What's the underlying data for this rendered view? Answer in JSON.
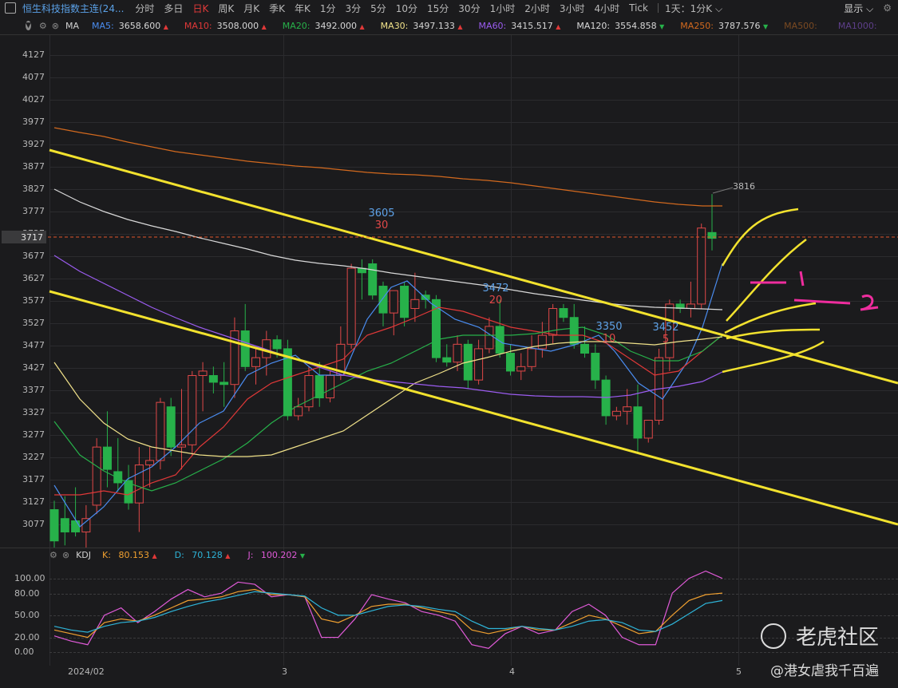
{
  "app": {
    "title": "恒生科技指数主连(24...",
    "display_label": "显示"
  },
  "timeframes": [
    "分时",
    "多日",
    "日K",
    "周K",
    "月K",
    "季K",
    "年K",
    "1分",
    "3分",
    "5分",
    "10分",
    "15分",
    "30分",
    "1小时",
    "2小时",
    "3小时",
    "4小时",
    "Tick"
  ],
  "active_timeframe": "日K",
  "period_select": "1天：1分K",
  "main_indicator": {
    "name": "MA",
    "items": [
      {
        "label": "MA5:",
        "value": "3658.600",
        "arrow": "▲",
        "color": "#4a8cf0"
      },
      {
        "label": "MA10:",
        "value": "3508.000",
        "arrow": "▲",
        "color": "#e03838"
      },
      {
        "label": "MA20:",
        "value": "3492.000",
        "arrow": "▲",
        "color": "#27b14a"
      },
      {
        "label": "MA30:",
        "value": "3497.133",
        "arrow": "▲",
        "color": "#f1e28a"
      },
      {
        "label": "MA60:",
        "value": "3415.517",
        "arrow": "▲",
        "color": "#9b5cf0"
      },
      {
        "label": "MA120:",
        "value": "3554.858",
        "arrow": "▼",
        "color": "#d9d9d9"
      },
      {
        "label": "MA250:",
        "value": "3787.576",
        "arrow": "▼",
        "color": "#d2691e"
      },
      {
        "label": "MA500:",
        "value": "",
        "arrow": "",
        "color": "#7a4a22"
      },
      {
        "label": "MA1000:",
        "value": "",
        "arrow": "",
        "color": "#5e3f8a"
      },
      {
        "label": "MA",
        "value": "",
        "arrow": "",
        "color": "#555555"
      }
    ]
  },
  "price_axis": [
    "4127",
    "4077",
    "4027",
    "3977",
    "3927",
    "3877",
    "3827",
    "3777",
    "3727",
    "3677",
    "3627",
    "3577",
    "3527",
    "3477",
    "3427",
    "3377",
    "3327",
    "3277",
    "3227",
    "3177",
    "3127",
    "3077"
  ],
  "current_price_label": "3717",
  "time_axis": [
    "2024/02",
    "3",
    "4",
    "5"
  ],
  "chart_annotations": [
    {
      "text": "3605",
      "color": "#5ea2e8"
    },
    {
      "text": "30",
      "color": "#e04848"
    },
    {
      "text": "3472",
      "color": "#5ea2e8"
    },
    {
      "text": "20",
      "color": "#e04848"
    },
    {
      "text": "3350",
      "color": "#5ea2e8"
    },
    {
      "text": "10",
      "color": "#e04848"
    },
    {
      "text": "3452",
      "color": "#5ea2e8"
    },
    {
      "text": "5",
      "color": "#e04848"
    },
    {
      "text": "3816",
      "color": "#bbbbbb"
    }
  ],
  "kdj": {
    "name": "KDJ",
    "items": [
      {
        "label": "K:",
        "value": "80.153",
        "arrow": "▲",
        "color": "#f0a030"
      },
      {
        "label": "D:",
        "value": "70.128",
        "arrow": "▲",
        "color": "#2eb4d8"
      },
      {
        "label": "J:",
        "value": "100.202",
        "arrow": "▼",
        "color": "#e05ad8"
      }
    ],
    "axis": [
      "100.00",
      "80.00",
      "50.00",
      "20.00",
      "0.00"
    ]
  },
  "watermark": {
    "brand": "老虎社区",
    "author": "@港女虐我千百遍"
  },
  "chart_data": {
    "type": "candlestick",
    "ylim": [
      3030,
      4150
    ],
    "candles": [
      {
        "o": 3110,
        "h": 3130,
        "l": 3020,
        "c": 3040
      },
      {
        "o": 3090,
        "h": 3140,
        "l": 3030,
        "c": 3060
      },
      {
        "o": 3085,
        "h": 3160,
        "l": 3050,
        "c": 3060
      },
      {
        "o": 3060,
        "h": 3120,
        "l": 3010,
        "c": 3090
      },
      {
        "o": 3120,
        "h": 3270,
        "l": 3100,
        "c": 3250
      },
      {
        "o": 3250,
        "h": 3330,
        "l": 3160,
        "c": 3200
      },
      {
        "o": 3195,
        "h": 3270,
        "l": 3150,
        "c": 3170
      },
      {
        "o": 3175,
        "h": 3210,
        "l": 3110,
        "c": 3125
      },
      {
        "o": 3125,
        "h": 3250,
        "l": 3060,
        "c": 3210
      },
      {
        "o": 3210,
        "h": 3250,
        "l": 3160,
        "c": 3220
      },
      {
        "o": 3220,
        "h": 3360,
        "l": 3200,
        "c": 3350
      },
      {
        "o": 3340,
        "h": 3360,
        "l": 3230,
        "c": 3250
      },
      {
        "o": 3250,
        "h": 3380,
        "l": 3200,
        "c": 3255
      },
      {
        "o": 3255,
        "h": 3420,
        "l": 3230,
        "c": 3410
      },
      {
        "o": 3410,
        "h": 3440,
        "l": 3330,
        "c": 3420
      },
      {
        "o": 3410,
        "h": 3430,
        "l": 3370,
        "c": 3395
      },
      {
        "o": 3395,
        "h": 3440,
        "l": 3340,
        "c": 3390
      },
      {
        "o": 3390,
        "h": 3540,
        "l": 3360,
        "c": 3510
      },
      {
        "o": 3510,
        "h": 3570,
        "l": 3420,
        "c": 3430
      },
      {
        "o": 3430,
        "h": 3470,
        "l": 3390,
        "c": 3450
      },
      {
        "o": 3450,
        "h": 3510,
        "l": 3410,
        "c": 3490
      },
      {
        "o": 3490,
        "h": 3500,
        "l": 3450,
        "c": 3470
      },
      {
        "o": 3470,
        "h": 3490,
        "l": 3310,
        "c": 3320
      },
      {
        "o": 3320,
        "h": 3360,
        "l": 3310,
        "c": 3340
      },
      {
        "o": 3340,
        "h": 3430,
        "l": 3330,
        "c": 3410
      },
      {
        "o": 3410,
        "h": 3440,
        "l": 3340,
        "c": 3360
      },
      {
        "o": 3360,
        "h": 3420,
        "l": 3350,
        "c": 3410
      },
      {
        "o": 3410,
        "h": 3520,
        "l": 3400,
        "c": 3480
      },
      {
        "o": 3480,
        "h": 3660,
        "l": 3470,
        "c": 3650
      },
      {
        "o": 3650,
        "h": 3670,
        "l": 3580,
        "c": 3640
      },
      {
        "o": 3660,
        "h": 3670,
        "l": 3580,
        "c": 3590
      },
      {
        "o": 3610,
        "h": 3620,
        "l": 3520,
        "c": 3550
      },
      {
        "o": 3550,
        "h": 3580,
        "l": 3500,
        "c": 3600
      },
      {
        "o": 3610,
        "h": 3620,
        "l": 3520,
        "c": 3540
      },
      {
        "o": 3560,
        "h": 3640,
        "l": 3530,
        "c": 3580
      },
      {
        "o": 3590,
        "h": 3600,
        "l": 3560,
        "c": 3580
      },
      {
        "o": 3580,
        "h": 3590,
        "l": 3440,
        "c": 3450
      },
      {
        "o": 3450,
        "h": 3480,
        "l": 3430,
        "c": 3440
      },
      {
        "o": 3440,
        "h": 3500,
        "l": 3420,
        "c": 3480
      },
      {
        "o": 3480,
        "h": 3490,
        "l": 3380,
        "c": 3400
      },
      {
        "o": 3400,
        "h": 3490,
        "l": 3390,
        "c": 3470
      },
      {
        "o": 3470,
        "h": 3540,
        "l": 3460,
        "c": 3520
      },
      {
        "o": 3520,
        "h": 3580,
        "l": 3450,
        "c": 3460
      },
      {
        "o": 3460,
        "h": 3480,
        "l": 3410,
        "c": 3420
      },
      {
        "o": 3420,
        "h": 3460,
        "l": 3400,
        "c": 3430
      },
      {
        "o": 3430,
        "h": 3500,
        "l": 3420,
        "c": 3470
      },
      {
        "o": 3470,
        "h": 3530,
        "l": 3450,
        "c": 3500
      },
      {
        "o": 3500,
        "h": 3570,
        "l": 3480,
        "c": 3560
      },
      {
        "o": 3560,
        "h": 3570,
        "l": 3530,
        "c": 3540
      },
      {
        "o": 3540,
        "h": 3570,
        "l": 3470,
        "c": 3480
      },
      {
        "o": 3480,
        "h": 3520,
        "l": 3450,
        "c": 3460
      },
      {
        "o": 3460,
        "h": 3480,
        "l": 3380,
        "c": 3400
      },
      {
        "o": 3400,
        "h": 3410,
        "l": 3300,
        "c": 3320
      },
      {
        "o": 3320,
        "h": 3340,
        "l": 3310,
        "c": 3330
      },
      {
        "o": 3330,
        "h": 3380,
        "l": 3300,
        "c": 3340
      },
      {
        "o": 3340,
        "h": 3390,
        "l": 3240,
        "c": 3270
      },
      {
        "o": 3270,
        "h": 3310,
        "l": 3260,
        "c": 3310
      },
      {
        "o": 3310,
        "h": 3470,
        "l": 3300,
        "c": 3450
      },
      {
        "o": 3450,
        "h": 3580,
        "l": 3420,
        "c": 3570
      },
      {
        "o": 3570,
        "h": 3580,
        "l": 3550,
        "c": 3560
      },
      {
        "o": 3560,
        "h": 3620,
        "l": 3540,
        "c": 3570
      },
      {
        "o": 3570,
        "h": 3750,
        "l": 3560,
        "c": 3740
      },
      {
        "o": 3730,
        "h": 3816,
        "l": 3690,
        "c": 3717
      }
    ]
  }
}
